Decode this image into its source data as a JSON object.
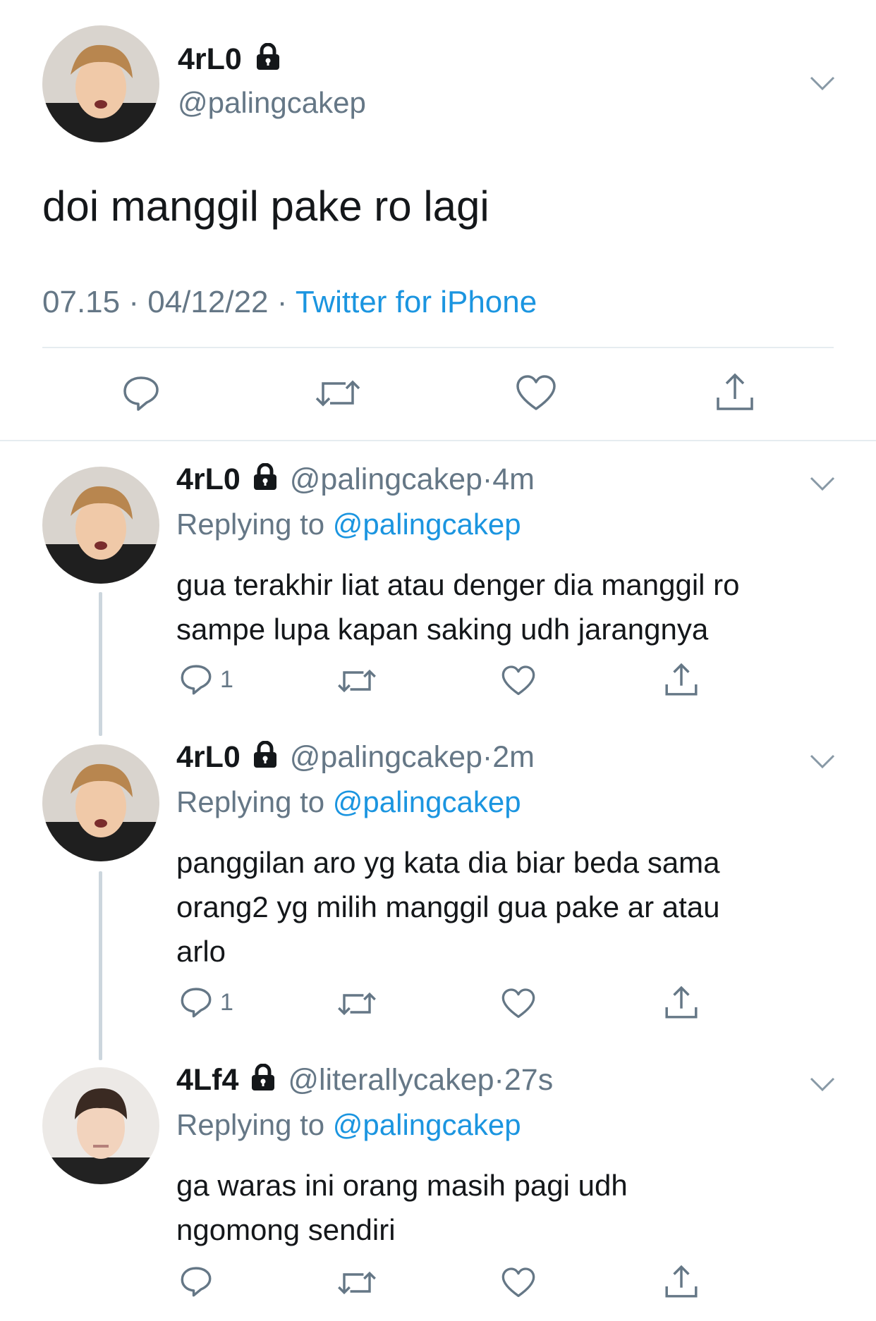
{
  "main_tweet": {
    "display_name": "4rL0",
    "handle": "@palingcakep",
    "text": "doi manggil pake ro lagi",
    "time": "07.15",
    "date": "04/12/22",
    "separator": "·",
    "source": "Twitter for iPhone"
  },
  "replies": [
    {
      "display_name": "4rL0",
      "handle": "@palingcakep",
      "separator": "·",
      "age": "4m",
      "replying_prefix": "Replying to",
      "replying_to": "@palingcakep",
      "line1": "gua terakhir liat atau denger dia manggil ro",
      "line2": "sampe lupa kapan saking udh jarangnya",
      "reply_count": "1"
    },
    {
      "display_name": "4rL0",
      "handle": "@palingcakep",
      "separator": "·",
      "age": "2m",
      "replying_prefix": "Replying to",
      "replying_to": "@palingcakep",
      "line1": "panggilan aro yg kata dia biar beda sama",
      "line2": "orang2 yg milih manggil gua pake ar atau",
      "line3": "arlo",
      "reply_count": "1"
    },
    {
      "display_name": "4Lf4",
      "handle": "@literallycakep",
      "separator": "·",
      "age": "27s",
      "replying_prefix": "Replying to",
      "replying_to": "@palingcakep",
      "line1": "ga waras ini orang masih pagi udh",
      "line2": "ngomong sendiri"
    }
  ],
  "icons": [
    "lock-icon",
    "chevron-down-icon",
    "reply-icon",
    "retweet-icon",
    "like-icon",
    "share-icon"
  ],
  "colors": {
    "link": "#1b95e0",
    "secondary_text": "#657786",
    "divider": "#e6ecf0",
    "thread_line": "#ccd6dd"
  }
}
